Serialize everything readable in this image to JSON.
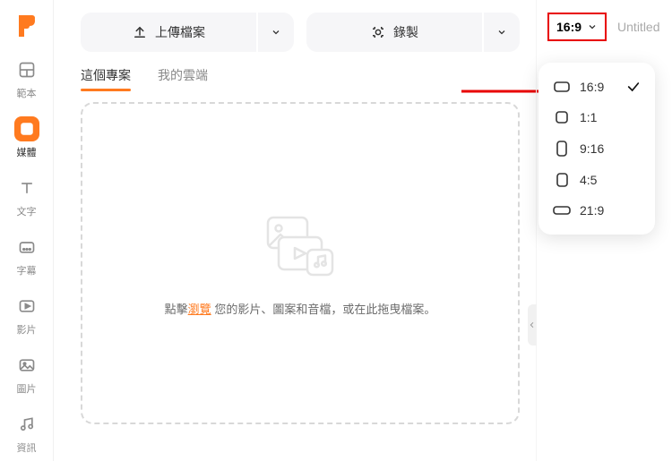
{
  "sidebar": {
    "items": [
      {
        "label": "範本"
      },
      {
        "label": "媒體"
      },
      {
        "label": "文字"
      },
      {
        "label": "字幕"
      },
      {
        "label": "影片"
      },
      {
        "label": "圖片"
      },
      {
        "label": "資訊"
      }
    ]
  },
  "top": {
    "upload": "上傳檔案",
    "record": "錄製"
  },
  "tabs": {
    "project": "這個專案",
    "cloud": "我的雲端"
  },
  "dropzone": {
    "prefix": "點擊",
    "link": "瀏覽",
    "suffix": "您的影片、圖案和音檔，或在此拖曳檔案。"
  },
  "right": {
    "selected": "16:9",
    "title": "Untitled",
    "options": [
      "16:9",
      "1:1",
      "9:16",
      "4:5",
      "21:9"
    ]
  }
}
